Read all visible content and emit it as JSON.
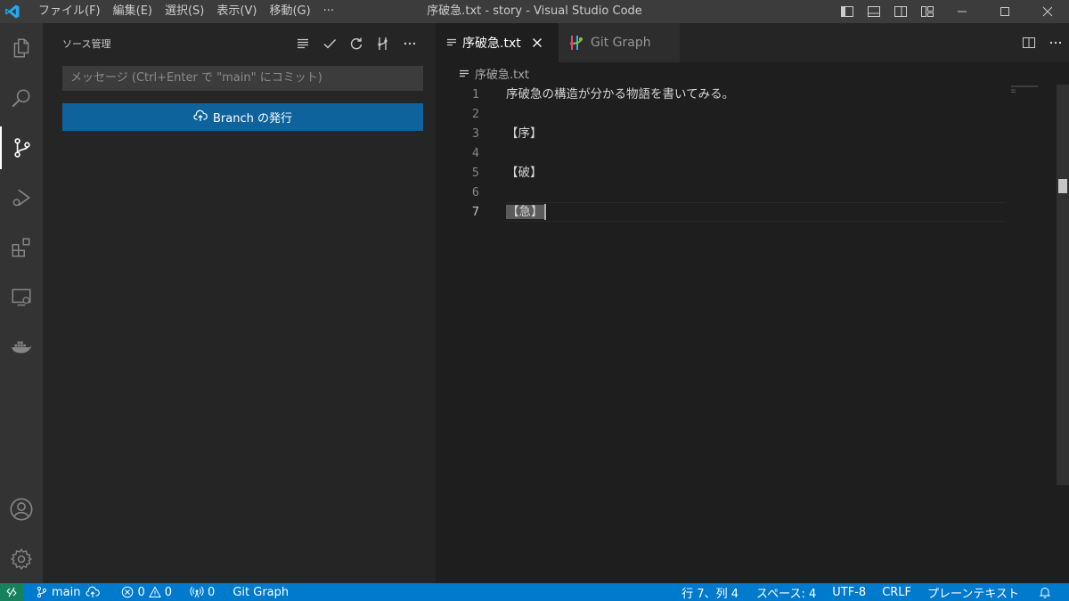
{
  "window": {
    "title": "序破急.txt - story - Visual Studio Code",
    "menu": [
      "ファイル(F)",
      "編集(E)",
      "選択(S)",
      "表示(V)",
      "移動(G)",
      "···"
    ]
  },
  "sidebar": {
    "title": "ソース管理",
    "message_placeholder": "メッセージ (Ctrl+Enter で \"main\" にコミット)",
    "publish_label": "Branch の発行"
  },
  "editor": {
    "tabs": [
      {
        "label": "序破急.txt",
        "active": true
      },
      {
        "label": "Git Graph",
        "active": false
      }
    ],
    "breadcrumb": "序破急.txt",
    "lines": [
      {
        "num": "1",
        "text": "序破急の構造が分かる物語を書いてみる。"
      },
      {
        "num": "2",
        "text": ""
      },
      {
        "num": "3",
        "text": "【序】"
      },
      {
        "num": "4",
        "text": ""
      },
      {
        "num": "5",
        "text": "【破】"
      },
      {
        "num": "6",
        "text": ""
      },
      {
        "num": "7",
        "text": "【急】"
      }
    ],
    "current_line": "7"
  },
  "statusbar": {
    "branch": "main",
    "errors": "0",
    "warnings": "0",
    "ports": "0",
    "git_graph": "Git Graph",
    "position": "行 7、列 4",
    "spaces": "スペース: 4",
    "encoding": "UTF-8",
    "eol": "CRLF",
    "language": "プレーンテキスト"
  },
  "colors": {
    "accent": "#007acc",
    "button": "#0e639c",
    "remote": "#16825d"
  }
}
